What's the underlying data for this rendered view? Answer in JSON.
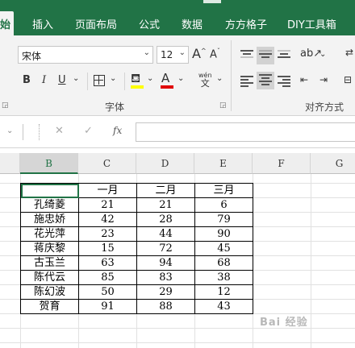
{
  "tabs": [
    "始",
    "插入",
    "页面布局",
    "公式",
    "数据",
    "方方格子",
    "DIY工具箱"
  ],
  "ribbon": {
    "font_name": "宋体",
    "font_size": "12",
    "grow_font": "A",
    "shrink_font": "A",
    "bold": "B",
    "italic": "I",
    "underline": "U",
    "font_color_letter": "A",
    "phonetic_top": "wén",
    "phonetic_bottom": "文",
    "group_font_label": "字体",
    "group_align_label": "对齐方式",
    "colors": {
      "highlight": "#ffff00",
      "font_color": "#e00000",
      "brand": "#217346"
    }
  },
  "formula_bar": {
    "cancel": "✕",
    "confirm": "✓",
    "function": "fx",
    "value": ""
  },
  "grid": {
    "columns": [
      "B",
      "C",
      "D",
      "E",
      "F",
      "G"
    ],
    "active_column": "B",
    "header_row": [
      "",
      "一月",
      "二月",
      "三月"
    ],
    "rows": [
      [
        "孔绮菱",
        "21",
        "21",
        "6"
      ],
      [
        "施忠娇",
        "42",
        "28",
        "79"
      ],
      [
        "花光萍",
        "23",
        "44",
        "90"
      ],
      [
        "蒋庆黎",
        "15",
        "72",
        "45"
      ],
      [
        "古玉兰",
        "63",
        "94",
        "68"
      ],
      [
        "陈代云",
        "85",
        "83",
        "38"
      ],
      [
        "陈幻波",
        "50",
        "29",
        "12"
      ],
      [
        "贺育",
        "91",
        "88",
        "43"
      ]
    ]
  },
  "watermark": "Bai 经验"
}
